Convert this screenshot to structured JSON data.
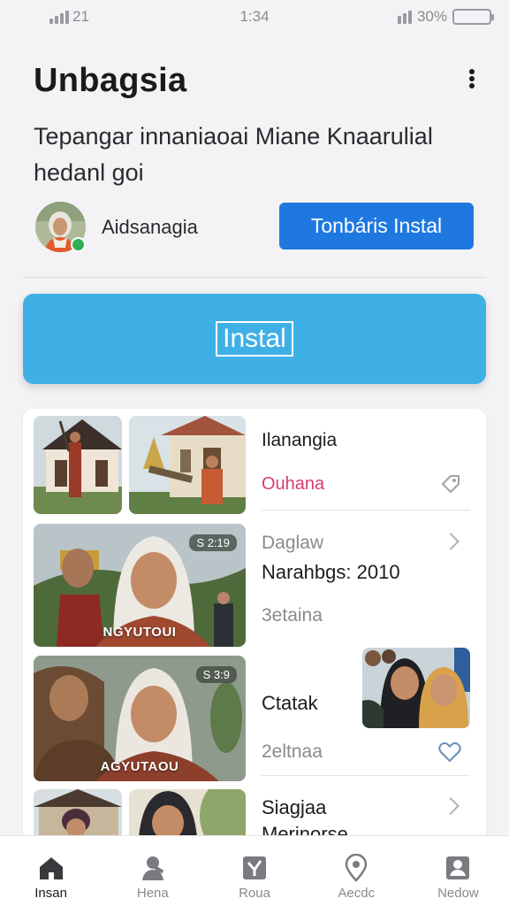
{
  "status_bar": {
    "signal_text": "21",
    "time": "1:34",
    "battery_text": "30%",
    "battery_level": 0.85,
    "battery_color": "#5bc45e"
  },
  "header": {
    "title": "Unbagsia",
    "more_icon": "more-vertical-icon",
    "subtitle": "Tepangar innaniaoai Miane Knaarulial hedanl goi"
  },
  "developer": {
    "name": "Aidsanagia",
    "button_label": "Tonbáris Instal",
    "button_color": "#1e78e0"
  },
  "install": {
    "label": "Instal",
    "color": "#3fb0e6"
  },
  "feed": {
    "row1": {
      "title": "Ilanangia",
      "subtitle": "Ouhana",
      "icon": "tag-icon"
    },
    "row2": {
      "label": "Daglaw",
      "title": "Narahbgs: 2010",
      "meta": "3etaina",
      "tag": "S 2:19",
      "caption": "NGYUTOUI",
      "icon": "chevron-right-icon"
    },
    "row3": {
      "title": "Ctatak",
      "meta": "2eltnaa",
      "tag": "S 3:9",
      "caption": "AGYUTAOU",
      "icon": "heart-icon"
    },
    "row4": {
      "title": "Siagjaa",
      "subtitle": "Merinorse",
      "icon": "chevron-right-icon"
    }
  },
  "bottom_nav": [
    {
      "label": "Insan",
      "icon": "home-icon",
      "active": true
    },
    {
      "label": "Hena",
      "icon": "person-icon",
      "active": false
    },
    {
      "label": "Roua",
      "icon": "check-square-icon",
      "active": false
    },
    {
      "label": "Aecdc",
      "icon": "location-pin-icon",
      "active": false
    },
    {
      "label": "Nedow",
      "icon": "profile-card-icon",
      "active": false
    }
  ]
}
